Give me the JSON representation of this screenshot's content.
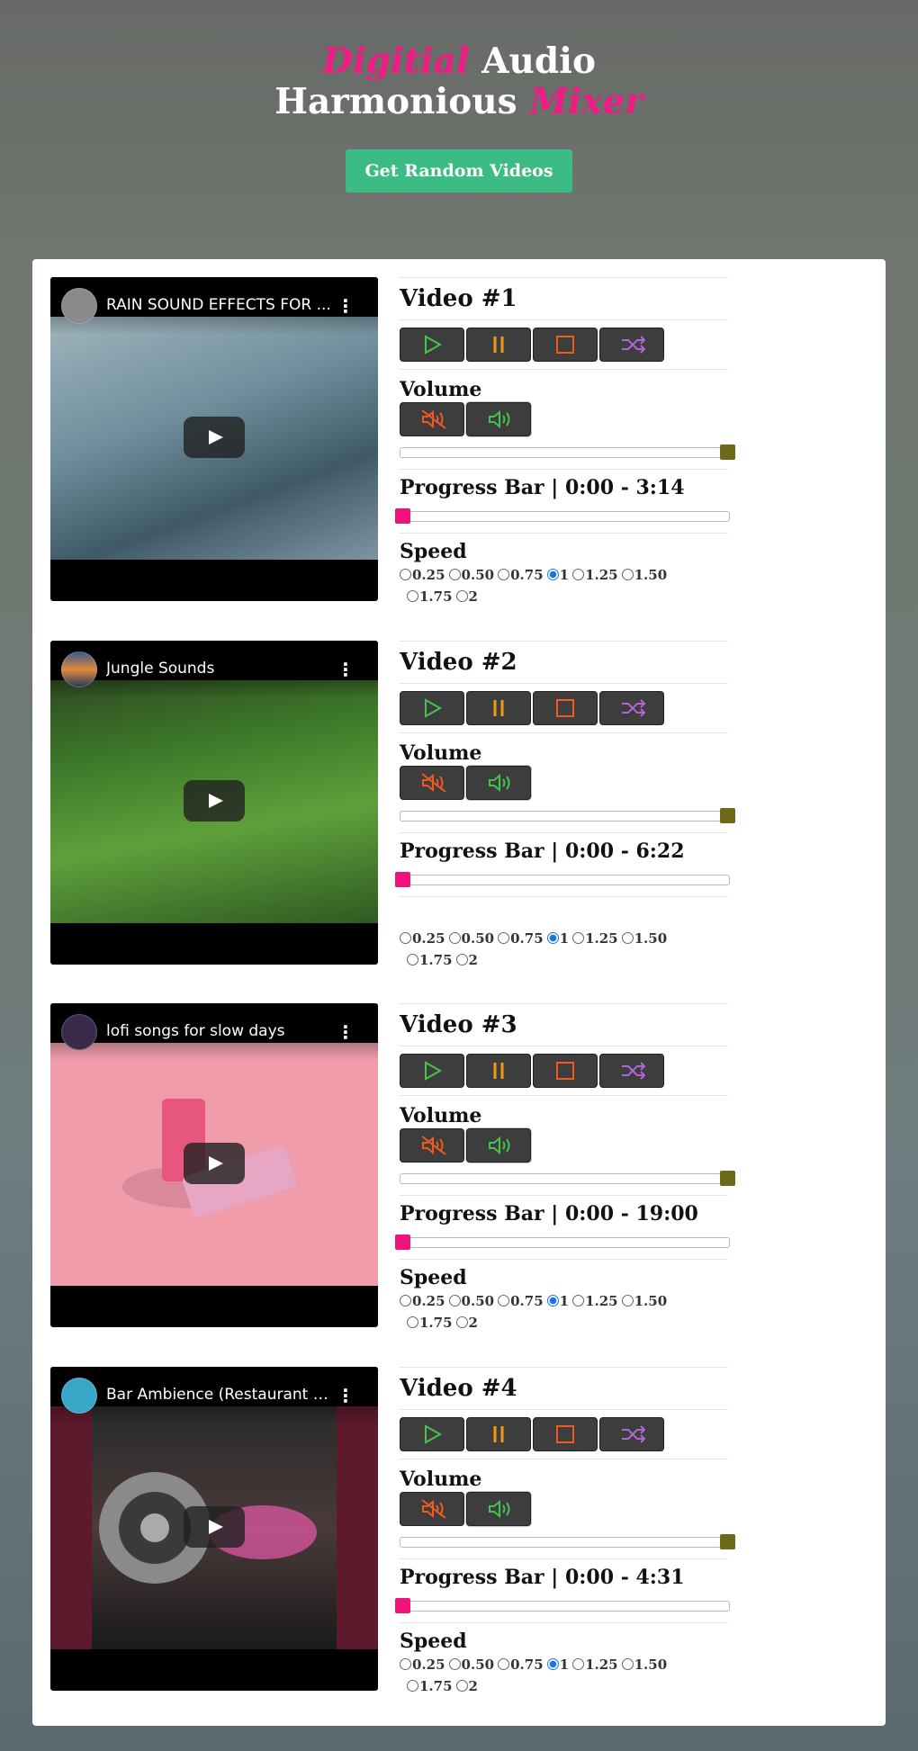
{
  "header": {
    "title_part1": "Digitial",
    "title_part2": " Audio",
    "title_part3": "Harmonious ",
    "title_part4": "Mixer",
    "random_button": "Get Random Videos"
  },
  "labels": {
    "volume": "Volume",
    "progress_prefix": "Progress Bar | ",
    "speed": "Speed"
  },
  "speed_options": [
    "0.25",
    "0.50",
    "0.75",
    "1",
    "1.25",
    "1.50",
    "1.75",
    "2"
  ],
  "selected_speed": "1",
  "colors": {
    "accent_pink": "#ee1c84",
    "cta_green": "#3dbb85",
    "volume_thumb": "#6f6a18",
    "progress_thumb": "#f0137b",
    "play_icon": "#44c44a",
    "pause_icon": "#f09a1a",
    "stop_icon": "#ee5a22",
    "shuffle_icon": "#b066d6"
  },
  "icons": [
    "play-icon",
    "pause-icon",
    "stop-icon",
    "shuffle-icon",
    "mute-icon",
    "volume-icon",
    "youtube-play-icon",
    "more-vert-icon"
  ],
  "videos": [
    {
      "heading": "Video #1",
      "player_title": "RAIN SOUND EFFECTS FOR ...",
      "time": "0:00 - 3:14",
      "volume": 1.0,
      "progress": 0.0,
      "show_speed_label": true
    },
    {
      "heading": "Video #2",
      "player_title": "Jungle Sounds",
      "time": "0:00 - 6:22",
      "volume": 1.0,
      "progress": 0.0,
      "show_speed_label": false
    },
    {
      "heading": "Video #3",
      "player_title": "lofi songs for slow days",
      "time": "0:00 - 19:00",
      "volume": 1.0,
      "progress": 0.0,
      "show_speed_label": true
    },
    {
      "heading": "Video #4",
      "player_title": "Bar Ambience (Restaurant P...",
      "time": "0:00 - 4:31",
      "volume": 1.0,
      "progress": 0.0,
      "show_speed_label": true
    }
  ]
}
